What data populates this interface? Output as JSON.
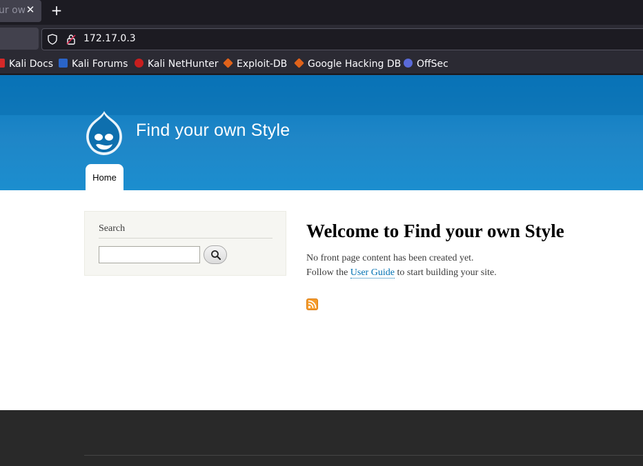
{
  "browser": {
    "tab_title": "ur ow",
    "tab_close": "✕",
    "new_tab": "+",
    "url": "172.17.0.3",
    "bookmarks": [
      {
        "label": "Kali Docs",
        "icon": "kali-docs-icon",
        "color": "#d62828"
      },
      {
        "label": "Kali Forums",
        "icon": "kali-forums-icon",
        "color": "#2a64c8"
      },
      {
        "label": "Kali NetHunter",
        "icon": "kali-nethunter-icon",
        "color": "#c81e1e"
      },
      {
        "label": "Exploit-DB",
        "icon": "exploit-db-icon",
        "color": "#e0621a"
      },
      {
        "label": "Google Hacking DB",
        "icon": "ghdb-icon",
        "color": "#e0621a"
      },
      {
        "label": "OffSec",
        "icon": "offsec-icon",
        "color": "#5a6ad8"
      }
    ]
  },
  "site": {
    "name": "Find your own Style",
    "nav": {
      "home_label": "Home"
    },
    "search": {
      "title": "Search",
      "input_value": "",
      "button_icon": "magnifier-icon"
    },
    "content": {
      "title": "Welcome to Find your own Style",
      "line1": "No front page content has been created yet.",
      "line2_prefix": "Follow the ",
      "line2_link": "User Guide",
      "line2_suffix": " to start building your site."
    },
    "colors": {
      "header_blue": "#0779bf",
      "link": "#0071b3",
      "footer": "#292929"
    }
  }
}
